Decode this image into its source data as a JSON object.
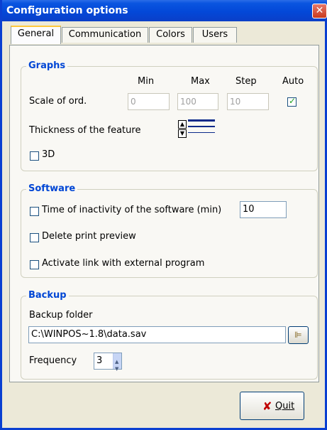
{
  "window": {
    "title": "Configuration options",
    "close_glyph": "✕"
  },
  "tabs": [
    {
      "label": "General",
      "active": true
    },
    {
      "label": "Communication",
      "active": false
    },
    {
      "label": "Colors",
      "active": false
    },
    {
      "label": "Users",
      "active": false
    }
  ],
  "graphs": {
    "title": "Graphs",
    "col_min": "Min",
    "col_max": "Max",
    "col_step": "Step",
    "col_auto": "Auto",
    "scale_label": "Scale of ord.",
    "min_value": "0",
    "max_value": "100",
    "step_value": "10",
    "auto_checked": true,
    "thickness_label": "Thickness of the feature",
    "three_d_label": "3D",
    "three_d_checked": false
  },
  "software": {
    "title": "Software",
    "inactivity_label": "Time of inactivity of the software (min)",
    "inactivity_checked": false,
    "inactivity_value": "10",
    "delete_preview_label": "Delete print preview",
    "delete_preview_checked": false,
    "activate_link_label": "Activate link with external program",
    "activate_link_checked": false
  },
  "backup": {
    "title": "Backup",
    "folder_label": "Backup folder",
    "folder_value": "C:\\WINPOS~1.8\\data.sav",
    "frequency_label": "Frequency",
    "frequency_value": "3"
  },
  "quit_label": "Quit",
  "icons": {
    "check": "checkmark-icon",
    "quit": "red-x-icon",
    "browse": "folder-tree-icon"
  },
  "colors": {
    "title_bar": "#0348d8",
    "group_title": "#0046d5",
    "tab_highlight": "#ffc83c",
    "quit_icon": "#c00000"
  }
}
